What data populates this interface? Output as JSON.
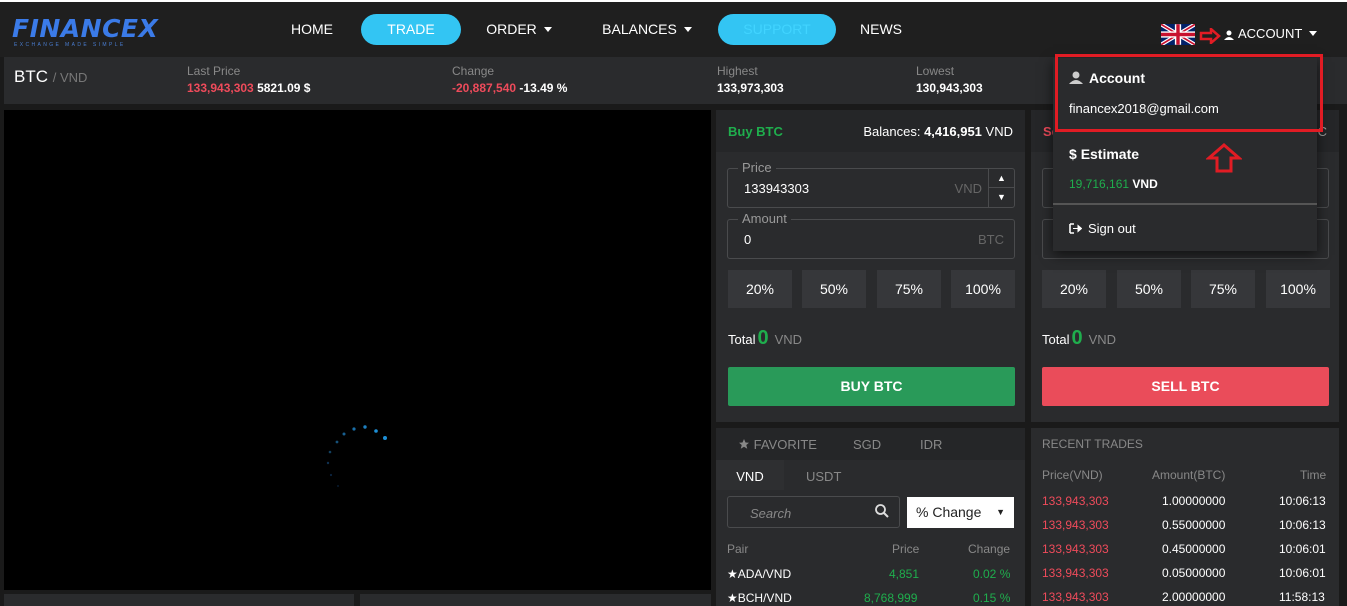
{
  "brand": {
    "name": "FINANCEX",
    "slogan": "EXCHANGE MADE SIMPLE"
  },
  "nav": {
    "home": "HOME",
    "trade": "TRADE",
    "order": "ORDER",
    "balances": "BALANCES",
    "support": "SUPPORT",
    "news": "NEWS",
    "account": "ACCOUNT"
  },
  "ticker": {
    "base": "BTC",
    "quote": "/ VND",
    "last_price_label": "Last Price",
    "last_price": "133,943,303",
    "last_price_usd": "5821.09 $",
    "change_label": "Change",
    "change_value": "-20,887,540",
    "change_pct": "-13.49 %",
    "highest_label": "Highest",
    "highest": "133,973,303",
    "lowest_label": "Lowest",
    "lowest": "130,943,303"
  },
  "buy": {
    "title": "Buy BTC",
    "balances_label": "Balances:",
    "balances_value": "4,416,951",
    "balances_unit": "VND",
    "price_label": "Price",
    "price_value": "133943303",
    "price_unit": "VND",
    "amount_label": "Amount",
    "amount_value": "0",
    "amount_unit": "BTC",
    "pct": [
      "20%",
      "50%",
      "75%",
      "100%"
    ],
    "total_label": "Total",
    "total_value": "0",
    "total_unit": "VND",
    "button": "BUY BTC"
  },
  "sell": {
    "title_partial": "Se",
    "balances_tail": "C",
    "pct": [
      "20%",
      "50%",
      "75%",
      "100%"
    ],
    "total_label": "Total",
    "total_value": "0",
    "total_unit": "VND",
    "button": "SELL BTC"
  },
  "market": {
    "tabs": [
      "FAVORITE",
      "SGD",
      "IDR"
    ],
    "sub_tabs": [
      "VND",
      "USDT"
    ],
    "search_placeholder": "Search",
    "sort_select": "% Change",
    "headers": {
      "pair": "Pair",
      "price": "Price",
      "change": "Change"
    },
    "rows": [
      {
        "pair": "ADA/VND",
        "price": "4,851",
        "change": "0.02 %"
      },
      {
        "pair": "BCH/VND",
        "price": "8,768,999",
        "change": "0.15 %"
      }
    ]
  },
  "recent_trades": {
    "title": "RECENT TRADES",
    "headers": {
      "price": "Price(VND)",
      "amount": "Amount(BTC)",
      "time": "Time"
    },
    "rows": [
      {
        "price": "133,943,303",
        "amount": "1.00000000",
        "time": "10:06:13"
      },
      {
        "price": "133,943,303",
        "amount": "0.55000000",
        "time": "10:06:13"
      },
      {
        "price": "133,943,303",
        "amount": "0.45000000",
        "time": "10:06:01"
      },
      {
        "price": "133,943,303",
        "amount": "0.05000000",
        "time": "10:06:01"
      },
      {
        "price": "133,943,303",
        "amount": "2.00000000",
        "time": "11:58:13"
      }
    ]
  },
  "account_menu": {
    "account_title": "Account",
    "email": "financex2018@gmail.com",
    "estimate_title": "Estimate",
    "estimate_value": "19,716,161",
    "estimate_unit": "VND",
    "sign_out": "Sign out"
  },
  "colors": {
    "accent": "#33c5f3",
    "buy": "#299a59",
    "sell": "#ea4c5a",
    "highlight": "#e11c24"
  }
}
